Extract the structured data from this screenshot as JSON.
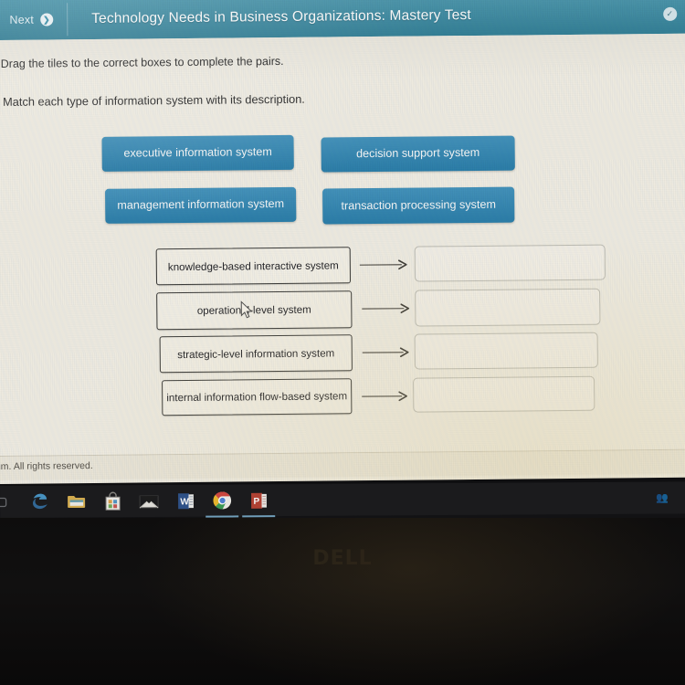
{
  "header": {
    "next_label": "Next",
    "next_icon": "arrow-right-circle-icon",
    "title": "Technology Needs in Business Organizations: Mastery Test",
    "status_icon": "check-circle-icon",
    "bg_color": "#3b92ac"
  },
  "instructions": {
    "line1": "Drag the tiles to the correct boxes to complete the pairs.",
    "line2": "Match each type of information system with its description."
  },
  "tiles": [
    {
      "label": "executive information system"
    },
    {
      "label": "decision support system"
    },
    {
      "label": "management information system"
    },
    {
      "label": "transaction processing system"
    }
  ],
  "tile_color": "#2e86b4",
  "rows": [
    {
      "prompt": "knowledge-based interactive system",
      "answer": "",
      "arrow_icon": "arrow-right-icon"
    },
    {
      "prompt": "operational-level system",
      "answer": "",
      "arrow_icon": "arrow-right-icon"
    },
    {
      "prompt": "strategic-level information system",
      "answer": "",
      "arrow_icon": "arrow-right-icon"
    },
    {
      "prompt": "internal information flow-based system",
      "answer": "",
      "arrow_icon": "arrow-right-icon"
    }
  ],
  "footer": {
    "copyright": "um. All rights reserved."
  },
  "taskbar": {
    "icons": [
      {
        "name": "cortana-search-icon",
        "active": false
      },
      {
        "name": "microsoft-edge-icon",
        "active": false
      },
      {
        "name": "file-explorer-icon",
        "active": false
      },
      {
        "name": "microsoft-store-icon",
        "active": false
      },
      {
        "name": "mail-icon",
        "active": false
      },
      {
        "name": "microsoft-word-icon",
        "active": false
      },
      {
        "name": "google-chrome-icon",
        "active": true
      },
      {
        "name": "microsoft-powerpoint-icon",
        "active": true
      }
    ],
    "tray_icon": "people-icon"
  },
  "device": {
    "brand": "DELL"
  },
  "cursor": {
    "icon": "mouse-pointer-icon"
  }
}
